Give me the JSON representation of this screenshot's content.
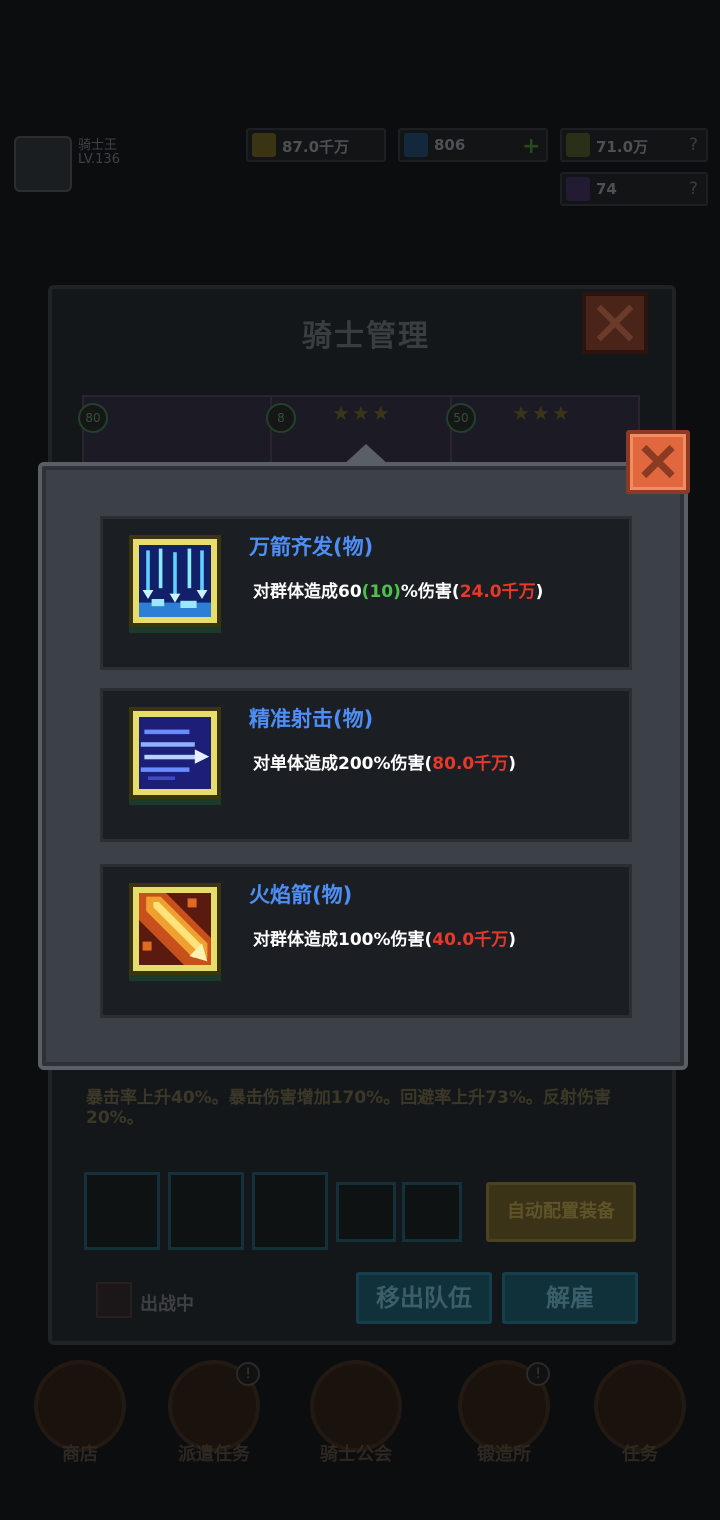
{
  "player": {
    "name": "骑士王",
    "level": "LV.136"
  },
  "resources": {
    "gold": "87.0千万",
    "gems": "806",
    "power": "71.0万",
    "tickets": "74"
  },
  "panel": {
    "title": "骑士管理",
    "characters": [
      {
        "level": "80",
        "stars": ""
      },
      {
        "level": "8",
        "stars": "★★★"
      },
      {
        "level": "50",
        "stars": "★★★"
      }
    ],
    "passive_text": "暴击率上升40%。暴击伤害增加170%。回避率上升73%。反射伤害20%。",
    "auto_equip_label": "自动配置装备",
    "on_battle_label": "出战中",
    "remove_team_label": "移出队伍",
    "dismiss_label": "解雇"
  },
  "skills": [
    {
      "name": "万箭齐发(物)",
      "desc_prefix": "对群体造成60",
      "desc_bonus": "(10)",
      "desc_mid": "%伤害(",
      "damage": "24.0千万",
      "desc_suffix": ")",
      "icon": "arrow-rain-icon"
    },
    {
      "name": "精准射击(物)",
      "desc_prefix": "对单体造成200%伤害(",
      "damage": "80.0千万",
      "desc_suffix": ")",
      "icon": "precise-shot-icon"
    },
    {
      "name": "火焰箭(物)",
      "desc_prefix": "对群体造成100%伤害(",
      "damage": "40.0千万",
      "desc_suffix": ")",
      "icon": "fire-arrow-icon"
    }
  ],
  "nav": [
    {
      "label": "商店",
      "badge": ""
    },
    {
      "label": "派遣任务",
      "badge": "!"
    },
    {
      "label": "骑士公会",
      "badge": ""
    },
    {
      "label": "锻造所",
      "badge": "!"
    },
    {
      "label": "任务",
      "badge": ""
    }
  ],
  "colors": {
    "skill_name": "#4d8ef7",
    "bonus": "#4cc24c",
    "damage": "#e8382a",
    "close": "#e0673e"
  }
}
